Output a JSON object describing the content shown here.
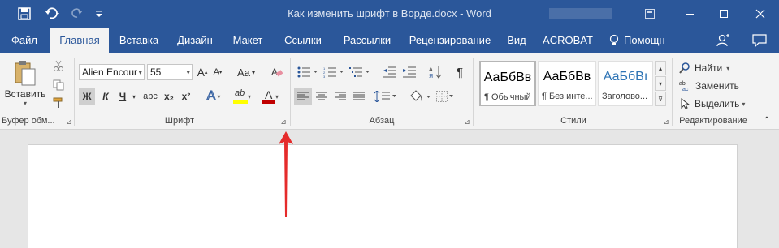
{
  "titlebar": {
    "title": "Как изменить шрифт в Ворде.docx - Word",
    "save_icon": "save-icon",
    "undo_icon": "undo-icon",
    "redo_icon": "redo-icon",
    "customize_icon": "customize-qat-icon"
  },
  "tabs": [
    {
      "label": "Файл"
    },
    {
      "label": "Главная"
    },
    {
      "label": "Вставка"
    },
    {
      "label": "Дизайн"
    },
    {
      "label": "Макет"
    },
    {
      "label": "Ссылки"
    },
    {
      "label": "Рассылки"
    },
    {
      "label": "Рецензирование"
    },
    {
      "label": "Вид"
    },
    {
      "label": "ACROBAT"
    },
    {
      "label": "Помощн"
    }
  ],
  "clipboard": {
    "paste_label": "Вставить",
    "group_label": "Буфер обм..."
  },
  "font": {
    "font_name": "Alien Encour",
    "font_size": "55",
    "grow": "A",
    "shrink": "A",
    "case": "Aa",
    "bold": "Ж",
    "italic": "К",
    "underline": "Ч",
    "strike": "abc",
    "subscript": "x₂",
    "superscript": "x²",
    "effects": "A",
    "highlight": "ab",
    "color": "A",
    "group_label": "Шрифт"
  },
  "paragraph": {
    "pilcrow": "¶",
    "group_label": "Абзац"
  },
  "styles": {
    "items": [
      {
        "sample": "АаБбВв",
        "name": "¶ Обычный"
      },
      {
        "sample": "АаБбВв",
        "name": "¶ Без инте..."
      },
      {
        "sample": "АаБбВı",
        "name": "Заголово..."
      }
    ],
    "group_label": "Стили"
  },
  "editing": {
    "find": "Найти",
    "replace": "Заменить",
    "select": "Выделить",
    "group_label": "Редактирование"
  },
  "colors": {
    "brand": "#2b579a",
    "arrow": "#e52b2b",
    "highlight": "#ffff00",
    "font_color": "#c00000"
  }
}
